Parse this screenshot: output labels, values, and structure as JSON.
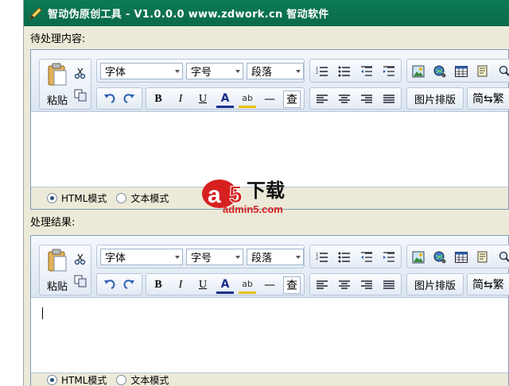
{
  "window": {
    "title": "智动伪原创工具   - V1.0.0.0  www.zdwork.cn 智动软件",
    "icon": "pen-icon"
  },
  "sections": {
    "input_label": "待处理内容:",
    "result_label": "处理结果:"
  },
  "toolbar": {
    "paste_label": "粘贴",
    "font_select": "字体",
    "size_select": "字号",
    "paragraph_select": "段落",
    "bold": "B",
    "italic": "I",
    "underline": "U",
    "font_color": "A",
    "highlight": "ab",
    "hr": "—",
    "find": "查",
    "image_layout": "图片排版",
    "simp_trad": "简⇆繁",
    "icons": [
      "paste-icon",
      "cut-icon",
      "copy-icon",
      "undo-icon",
      "redo-icon",
      "ordered-list-icon",
      "unordered-list-icon",
      "outdent-icon",
      "indent-icon",
      "align-left-icon",
      "align-center-icon",
      "align-right-icon",
      "justify-icon",
      "image-icon",
      "flash-icon",
      "table-icon",
      "template-icon",
      "preview-icon"
    ]
  },
  "modes": {
    "html": "HTML模式",
    "text": "文本模式"
  },
  "watermark": {
    "logo": "a5下载",
    "site": "admin5.com"
  }
}
